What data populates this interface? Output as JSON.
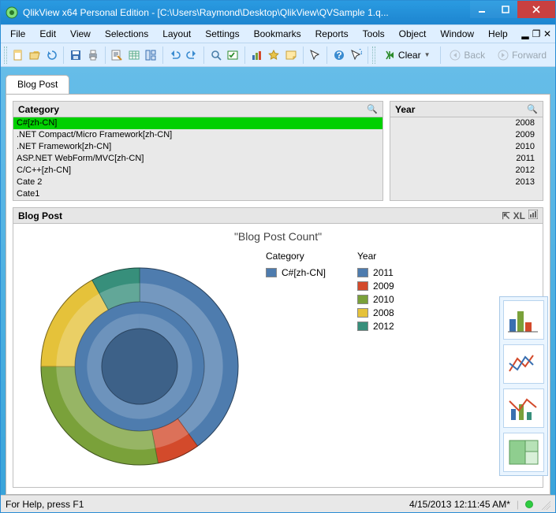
{
  "window": {
    "title": "QlikView x64 Personal Edition - [C:\\Users\\Raymond\\Desktop\\QlikView\\QVSample 1.q..."
  },
  "menubar": [
    "File",
    "Edit",
    "View",
    "Selections",
    "Layout",
    "Settings",
    "Bookmarks",
    "Reports",
    "Tools",
    "Object",
    "Window",
    "Help"
  ],
  "toolbar": {
    "clear_label": "Clear",
    "back_label": "Back",
    "forward_label": "Forward"
  },
  "sheet": {
    "tab": "Blog Post"
  },
  "category_box": {
    "title": "Category",
    "items": [
      {
        "label": "C#[zh-CN]",
        "selected": true
      },
      {
        "label": ".NET Compact/Micro Framework[zh-CN]",
        "selected": false
      },
      {
        "label": ".NET Framework[zh-CN]",
        "selected": false
      },
      {
        "label": "ASP.NET WebForm/MVC[zh-CN]",
        "selected": false
      },
      {
        "label": "C/C++[zh-CN]",
        "selected": false
      },
      {
        "label": "Cate 2",
        "selected": false
      },
      {
        "label": "Cate1",
        "selected": false
      }
    ]
  },
  "year_box": {
    "title": "Year",
    "items": [
      "2008",
      "2009",
      "2010",
      "2011",
      "2012",
      "2013"
    ]
  },
  "chart_box": {
    "title": "Blog Post",
    "tool_label_xl": "XL",
    "chart_title": "\"Blog Post Count\"",
    "legend_cat_title": "Category",
    "legend_cat_items": [
      {
        "label": "C#[zh-CN]",
        "color": "#4e7cae"
      }
    ],
    "legend_year_title": "Year",
    "legend_year_items": [
      {
        "label": "2011",
        "color": "#4e7cae"
      },
      {
        "label": "2009",
        "color": "#d34a2b"
      },
      {
        "label": "2010",
        "color": "#7aa13a"
      },
      {
        "label": "2008",
        "color": "#e5c23a"
      },
      {
        "label": "2012",
        "color": "#378f7b"
      }
    ]
  },
  "chart_data": {
    "type": "pie",
    "title": "\"Blog Post Count\"",
    "inner_ring": {
      "dimension": "Category",
      "series": [
        {
          "name": "C#[zh-CN]",
          "value": 100,
          "color": "#4e7cae"
        }
      ]
    },
    "outer_ring": {
      "dimension": "Year",
      "series": [
        {
          "name": "2011",
          "value": 40,
          "color": "#4e7cae",
          "start": 0
        },
        {
          "name": "2009",
          "value": 7,
          "color": "#d34a2b",
          "start": 40
        },
        {
          "name": "2010",
          "value": 28,
          "color": "#7aa13a",
          "start": 47
        },
        {
          "name": "2008",
          "value": 17,
          "color": "#e5c23a",
          "start": 75
        },
        {
          "name": "2012",
          "value": 8,
          "color": "#378f7b",
          "start": 92
        }
      ]
    }
  },
  "statusbar": {
    "help": "For Help, press F1",
    "datetime": "4/15/2013 12:11:45 AM*"
  }
}
